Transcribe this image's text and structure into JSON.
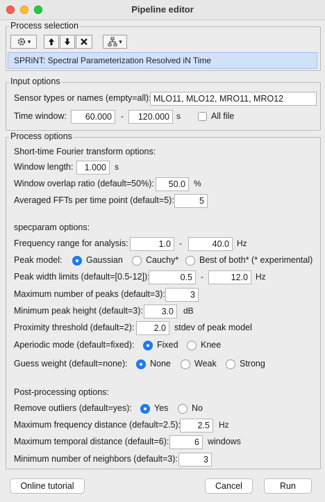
{
  "window": {
    "title": "Pipeline editor"
  },
  "process_selection": {
    "legend": "Process selection",
    "toolbar": {
      "gear_icon": "gear-icon",
      "dropdown_glyph": "▾",
      "up_glyph": "🠑",
      "down_glyph": "🠓",
      "delete_glyph": "✖",
      "tree_glyph": "⛬"
    },
    "selected_process": "SPRiNT: Spectral Parameterization Resolved iN Time"
  },
  "input_options": {
    "legend": "Input options",
    "sensor_label": "Sensor types or names (empty=all):",
    "sensor_value": "MLO11, MLO12, MRO11, MRO12",
    "time_label": "Time window:",
    "time_start": "60.000",
    "time_dash": "-",
    "time_end": "120.000",
    "time_unit": "s",
    "all_file_label": "All file"
  },
  "process_options": {
    "legend": "Process options",
    "stft_heading": "Short-time Fourier transform options:",
    "window_length_label": "Window length:",
    "window_length_value": "1.000",
    "window_length_unit": "s",
    "overlap_label": "Window overlap ratio (default=50%):",
    "overlap_value": "50.0",
    "overlap_unit": "%",
    "avg_ffts_label": "Averaged FFTs per time point (default=5):",
    "avg_ffts_value": "5",
    "specparam_heading": "specparam options:",
    "freq_range_label": "Frequency range for analysis:",
    "freq_range_min": "1.0",
    "freq_range_dash": "-",
    "freq_range_max": "40.0",
    "freq_range_unit": "Hz",
    "peak_model_label": "Peak model:",
    "peak_model_options": [
      "Gaussian",
      "Cauchy*",
      "Best of both* (* experimental)"
    ],
    "peak_width_label": "Peak width limits (default=[0.5-12]):",
    "peak_width_min": "0.5",
    "peak_width_dash": "-",
    "peak_width_max": "12.0",
    "peak_width_unit": "Hz",
    "max_peaks_label": "Maximum number of peaks (default=3):",
    "max_peaks_value": "3",
    "min_peak_height_label": "Minimum peak height (default=3):",
    "min_peak_height_value": "3.0",
    "min_peak_height_unit": "dB",
    "proximity_label": "Proximity threshold (default=2):",
    "proximity_value": "2.0",
    "proximity_unit": "stdev of peak model",
    "aperiodic_label": "Aperiodic mode (default=fixed):",
    "aperiodic_options": [
      "Fixed",
      "Knee"
    ],
    "guess_weight_label": "Guess weight (default=none):",
    "guess_weight_options": [
      "None",
      "Weak",
      "Strong"
    ],
    "post_heading": "Post-processing options:",
    "remove_outliers_label": "Remove outliers (default=yes):",
    "remove_outliers_options": [
      "Yes",
      "No"
    ],
    "max_freq_dist_label": "Maximum frequency distance (default=2.5):",
    "max_freq_dist_value": "2.5",
    "max_freq_dist_unit": "Hz",
    "max_temp_dist_label": "Maximum temporal distance (default=6):",
    "max_temp_dist_value": "6",
    "max_temp_dist_unit": "windows",
    "min_neighbors_label": "Minimum number of neighbors (default=3):",
    "min_neighbors_value": "3"
  },
  "buttons": {
    "tutorial": "Online tutorial",
    "cancel": "Cancel",
    "run": "Run"
  },
  "colors": {
    "accent": "#1a7ef7",
    "selection": "#cfe2f7"
  }
}
